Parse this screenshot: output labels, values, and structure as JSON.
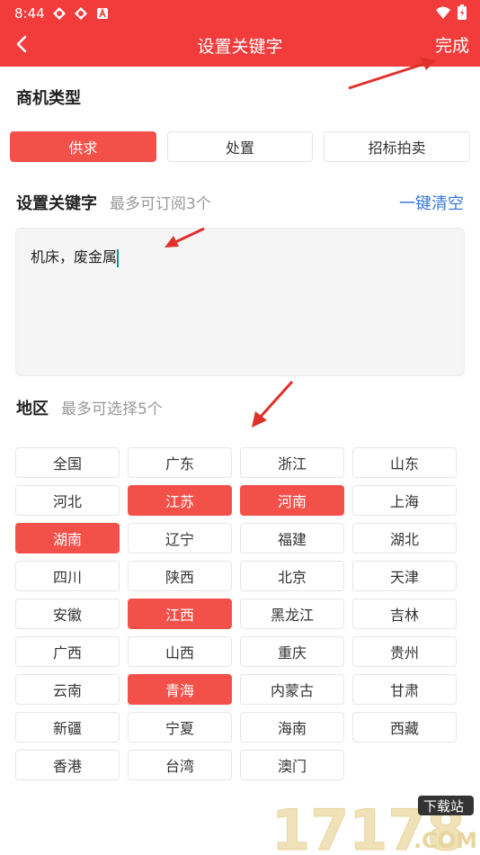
{
  "status": {
    "time": "8:44"
  },
  "nav": {
    "title": "设置关键字",
    "done": "完成"
  },
  "business_type": {
    "title": "商机类型",
    "options": [
      {
        "label": "供求",
        "selected": true
      },
      {
        "label": "处置",
        "selected": false
      },
      {
        "label": "招标拍卖",
        "selected": false
      }
    ]
  },
  "keywords": {
    "title": "设置关键字",
    "hint": "最多可订阅3个",
    "clear": "一键清空",
    "value": "机床，废金属"
  },
  "region": {
    "title": "地区",
    "hint": "最多可选择5个",
    "items": [
      {
        "label": "全国",
        "selected": false
      },
      {
        "label": "广东",
        "selected": false
      },
      {
        "label": "浙江",
        "selected": false
      },
      {
        "label": "山东",
        "selected": false
      },
      {
        "label": "河北",
        "selected": false
      },
      {
        "label": "江苏",
        "selected": true
      },
      {
        "label": "河南",
        "selected": true
      },
      {
        "label": "上海",
        "selected": false
      },
      {
        "label": "湖南",
        "selected": true
      },
      {
        "label": "辽宁",
        "selected": false
      },
      {
        "label": "福建",
        "selected": false
      },
      {
        "label": "湖北",
        "selected": false
      },
      {
        "label": "四川",
        "selected": false
      },
      {
        "label": "陕西",
        "selected": false
      },
      {
        "label": "北京",
        "selected": false
      },
      {
        "label": "天津",
        "selected": false
      },
      {
        "label": "安徽",
        "selected": false
      },
      {
        "label": "江西",
        "selected": true
      },
      {
        "label": "黑龙江",
        "selected": false
      },
      {
        "label": "吉林",
        "selected": false
      },
      {
        "label": "广西",
        "selected": false
      },
      {
        "label": "山西",
        "selected": false
      },
      {
        "label": "重庆",
        "selected": false
      },
      {
        "label": "贵州",
        "selected": false
      },
      {
        "label": "云南",
        "selected": false
      },
      {
        "label": "青海",
        "selected": true
      },
      {
        "label": "内蒙古",
        "selected": false
      },
      {
        "label": "甘肃",
        "selected": false
      },
      {
        "label": "新疆",
        "selected": false
      },
      {
        "label": "宁夏",
        "selected": false
      },
      {
        "label": "海南",
        "selected": false
      },
      {
        "label": "西藏",
        "selected": false
      },
      {
        "label": "香港",
        "selected": false
      },
      {
        "label": "台湾",
        "selected": false
      },
      {
        "label": "澳门",
        "selected": false
      }
    ]
  },
  "watermark": {
    "text": "17178",
    "sub": "下载站",
    "domain": ".COM"
  },
  "colors": {
    "brand": "#f23b3b",
    "chip_active": "#f4504a",
    "link": "#3a78d8"
  }
}
